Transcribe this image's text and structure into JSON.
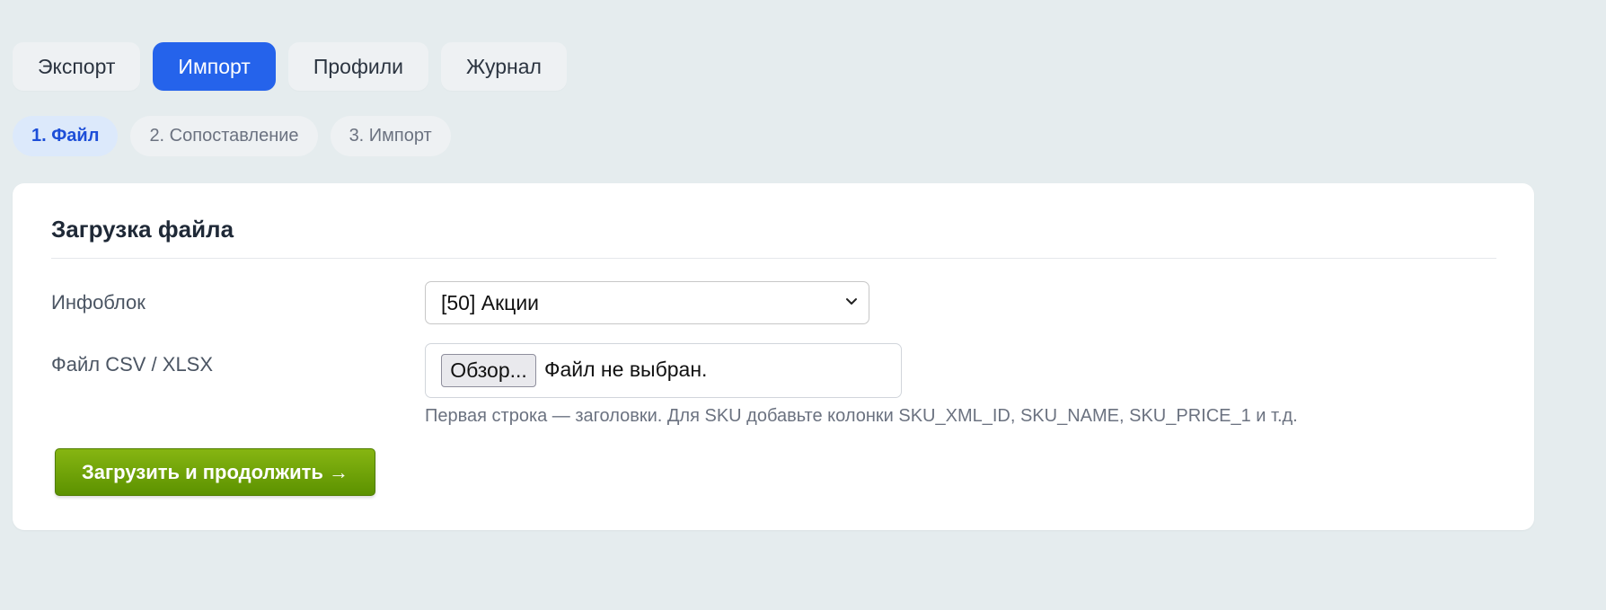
{
  "tabs": [
    {
      "label": "Экспорт",
      "active": false
    },
    {
      "label": "Импорт",
      "active": true
    },
    {
      "label": "Профили",
      "active": false
    },
    {
      "label": "Журнал",
      "active": false
    }
  ],
  "steps": [
    {
      "label": "1. Файл",
      "active": true
    },
    {
      "label": "2. Сопоставление",
      "active": false
    },
    {
      "label": "3. Импорт",
      "active": false
    }
  ],
  "card": {
    "title": "Загрузка файла",
    "iblock_label": "Инфоблок",
    "iblock_value": "[50] Акции",
    "file_label": "Файл CSV / XLSX",
    "browse_label": "Обзор...",
    "file_status": "Файл не выбран.",
    "hint": "Первая строка — заголовки. Для SKU добавьте колонки SKU_XML_ID, SKU_NAME, SKU_PRICE_1 и т.д.",
    "submit_label": "Загрузить и продолжить →"
  },
  "colors": {
    "accent": "#2563eb",
    "submit": "#6fa70a",
    "background": "#e5ecee"
  }
}
